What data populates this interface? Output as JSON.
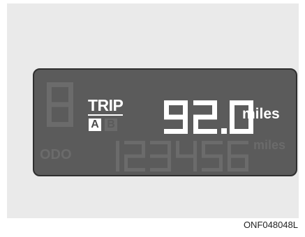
{
  "display": {
    "trip_label": "TRIP",
    "trip_a": "A",
    "trip_b": "B",
    "trip_value": "92.0",
    "trip_unit": "miles",
    "odo_label": "ODO",
    "odo_value": "123456",
    "odo_unit": "miles"
  },
  "figure_code": "ONF048048L",
  "colors": {
    "lcd_background": "#5b5b5b",
    "active_segment": "#ffffff",
    "inactive_segment": "#6b6b6b",
    "panel": "#eaeaea"
  }
}
